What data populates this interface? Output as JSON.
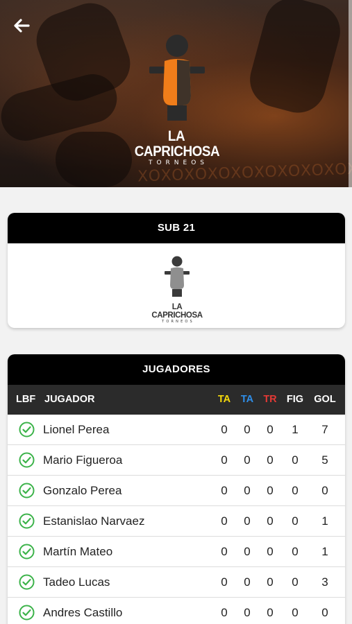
{
  "header": {
    "brand_line1": "LA CAPRICHOSA",
    "brand_line2": "TORNEOS",
    "watermark": "XOXOXOXOXOXOXOXOXOX"
  },
  "category": {
    "title": "SUB 21",
    "brand_line1": "LA CAPRICHOSA",
    "brand_line2": "TORNEOS"
  },
  "players": {
    "title": "JUGADORES",
    "columns": {
      "lbf": "LBF",
      "player": "JUGADOR",
      "ta_yellow": "TA",
      "ta_blue": "TA",
      "tr": "TR",
      "fig": "FIG",
      "gol": "GOL"
    },
    "column_colors": {
      "ta_yellow": "#f5d90a",
      "ta_blue": "#2f8ee8",
      "tr": "#e53935"
    },
    "rows": [
      {
        "name": "Lionel Perea",
        "ta1": "0",
        "ta2": "0",
        "tr": "0",
        "fig": "1",
        "gol": "7"
      },
      {
        "name": "Mario Figueroa",
        "ta1": "0",
        "ta2": "0",
        "tr": "0",
        "fig": "0",
        "gol": "5"
      },
      {
        "name": "Gonzalo Perea",
        "ta1": "0",
        "ta2": "0",
        "tr": "0",
        "fig": "0",
        "gol": "0"
      },
      {
        "name": "Estanislao Narvaez",
        "ta1": "0",
        "ta2": "0",
        "tr": "0",
        "fig": "0",
        "gol": "1"
      },
      {
        "name": "Martín Mateo",
        "ta1": "0",
        "ta2": "0",
        "tr": "0",
        "fig": "0",
        "gol": "1"
      },
      {
        "name": "Tadeo Lucas",
        "ta1": "0",
        "ta2": "0",
        "tr": "0",
        "fig": "0",
        "gol": "3"
      },
      {
        "name": "Andres Castillo",
        "ta1": "0",
        "ta2": "0",
        "tr": "0",
        "fig": "0",
        "gol": "0"
      }
    ]
  },
  "colors": {
    "accent_orange": "#f07d1a",
    "check_green": "#3cb34a",
    "header_black": "#000000"
  },
  "icons": {
    "back": "arrow-left-icon",
    "lbf_status": "check-circle-icon",
    "logo": "foosball-player-icon"
  }
}
